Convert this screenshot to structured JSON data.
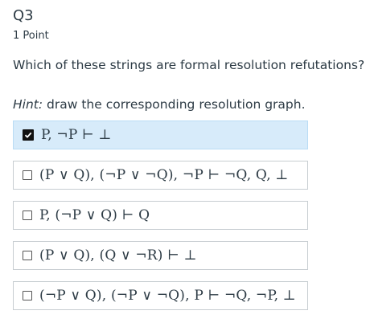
{
  "question": {
    "title": "Q3",
    "points": "1 Point",
    "prompt": "Which of these strings are formal resolution refutations?",
    "hint_label": "Hint:",
    "hint_text": " draw the corresponding resolution graph."
  },
  "options": [
    {
      "text": "P, ¬P ⊢ ⊥",
      "checked": true
    },
    {
      "text": "(P ∨ Q), (¬P ∨ ¬Q), ¬P ⊢ ¬Q, Q, ⊥",
      "checked": false
    },
    {
      "text": "P, (¬P ∨ Q) ⊢ Q",
      "checked": false
    },
    {
      "text": "(P ∨ Q), (Q ∨ ¬R) ⊢ ⊥",
      "checked": false
    },
    {
      "text": "(¬P ∨ Q), (¬P ∨ ¬Q), P ⊢ ¬Q, ¬P, ⊥",
      "checked": false
    }
  ],
  "colors": {
    "selected_bg": "#d7ebfa",
    "border": "#c7cdd1",
    "text": "#2d3b45"
  }
}
